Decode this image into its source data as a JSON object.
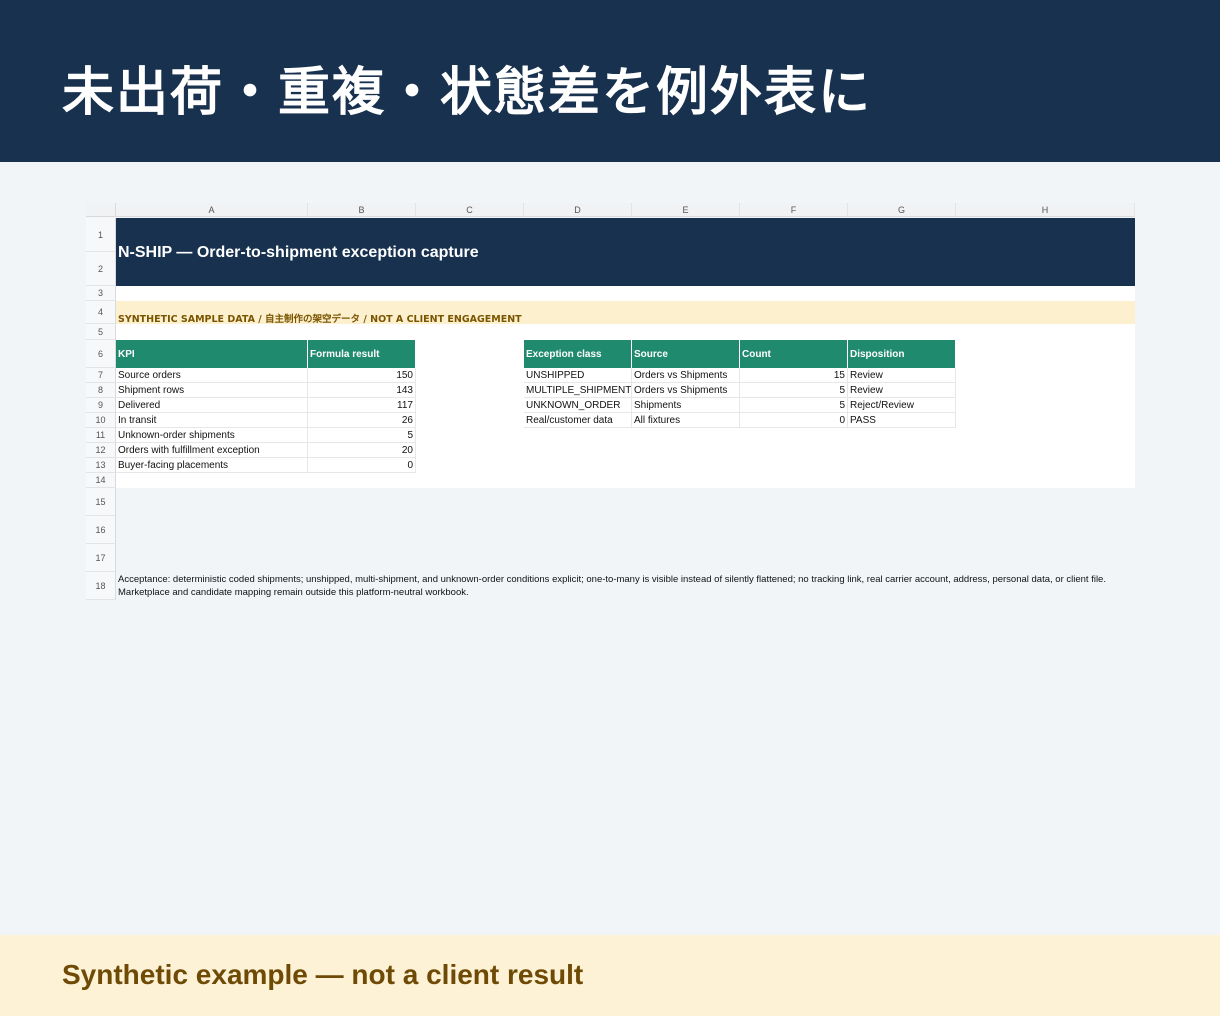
{
  "banner": {
    "title": "未出荷・重複・状態差を例外表に"
  },
  "sheet": {
    "columns": [
      "A",
      "B",
      "C",
      "D",
      "E",
      "F",
      "G",
      "H"
    ],
    "rows": [
      "1",
      "2",
      "3",
      "4",
      "5",
      "6",
      "7",
      "8",
      "9",
      "10",
      "11",
      "12",
      "13",
      "14",
      "15",
      "16",
      "17",
      "18"
    ],
    "title": "N-SHIP — Order-to-shipment exception capture",
    "notice": "SYNTHETIC SAMPLE DATA / 自主制作の架空データ / NOT A CLIENT ENGAGEMENT",
    "kpi_table": {
      "headers": [
        "KPI",
        "Formula result"
      ],
      "rows": [
        {
          "kpi": "Source orders",
          "value": "150"
        },
        {
          "kpi": "Shipment rows",
          "value": "143"
        },
        {
          "kpi": "Delivered",
          "value": "117"
        },
        {
          "kpi": "In transit",
          "value": "26"
        },
        {
          "kpi": "Unknown-order shipments",
          "value": "5"
        },
        {
          "kpi": "Orders with fulfillment exception",
          "value": "20"
        },
        {
          "kpi": "Buyer-facing placements",
          "value": "0"
        }
      ]
    },
    "exception_table": {
      "headers": [
        "Exception class",
        "Source",
        "Count",
        "Disposition"
      ],
      "rows": [
        {
          "cls": "UNSHIPPED",
          "source": "Orders vs Shipments",
          "count": "15",
          "disposition": "Review"
        },
        {
          "cls": "MULTIPLE_SHIPMENTS",
          "source": "Orders vs Shipments",
          "count": "5",
          "disposition": "Review"
        },
        {
          "cls": "UNKNOWN_ORDER",
          "source": "Shipments",
          "count": "5",
          "disposition": "Reject/Review"
        },
        {
          "cls": "Real/customer data",
          "source": "All fixtures",
          "count": "0",
          "disposition": "PASS"
        }
      ]
    },
    "acceptance": "Acceptance: deterministic coded shipments; unshipped, multi-shipment, and unknown-order conditions explicit; one-to-many is visible instead of silently flattened; no tracking link, real carrier account, address, personal data, or client file. Marketplace and candidate mapping remain outside this platform-neutral workbook."
  },
  "footer": {
    "text": "Synthetic example — not a client result"
  },
  "colors": {
    "navy": "#18314f",
    "green": "#208a6e",
    "notice_bg": "#fdf0cf",
    "footer_bg": "#fdf1d6",
    "footer_text": "#6e4a05"
  }
}
